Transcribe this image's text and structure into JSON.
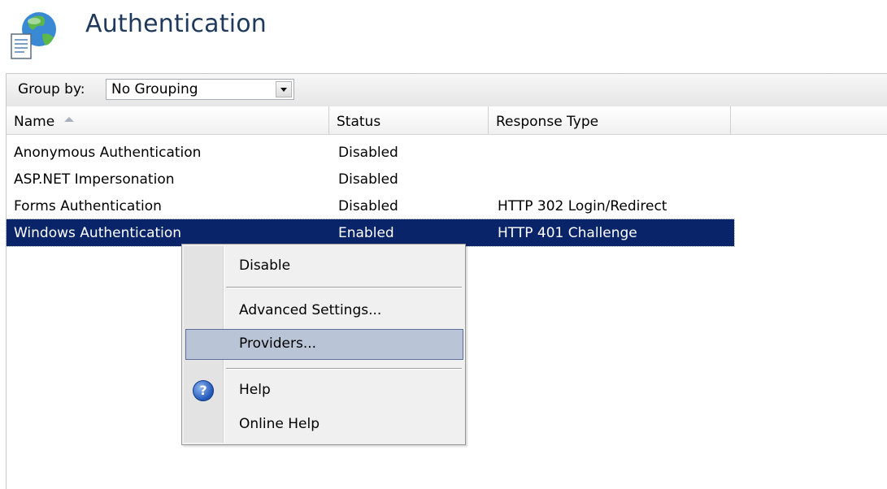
{
  "header": {
    "title": "Authentication",
    "icon": "authentication-feature-icon"
  },
  "groupbar": {
    "label": "Group by:",
    "value": "No Grouping"
  },
  "columns": [
    {
      "label": "Name",
      "sort": "ascending"
    },
    {
      "label": "Status"
    },
    {
      "label": "Response Type"
    },
    {
      "label": ""
    }
  ],
  "rows": [
    {
      "name": "Anonymous Authentication",
      "status": "Disabled",
      "response": ""
    },
    {
      "name": "ASP.NET Impersonation",
      "status": "Disabled",
      "response": ""
    },
    {
      "name": "Forms Authentication",
      "status": "Disabled",
      "response": "HTTP 302 Login/Redirect"
    },
    {
      "name": "Windows Authentication",
      "status": "Enabled",
      "response": "HTTP 401 Challenge",
      "selected": true
    }
  ],
  "context_menu": {
    "items": [
      {
        "label": "Disable"
      },
      {
        "label": "Advanced Settings..."
      },
      {
        "label": "Providers...",
        "highlighted": true
      },
      {
        "label": "Help",
        "icon": "help-icon"
      },
      {
        "label": "Online Help"
      }
    ]
  },
  "colors": {
    "selection": "#0a246a",
    "menu_highlight": "#b9c4d6",
    "title": "#1e395b"
  }
}
